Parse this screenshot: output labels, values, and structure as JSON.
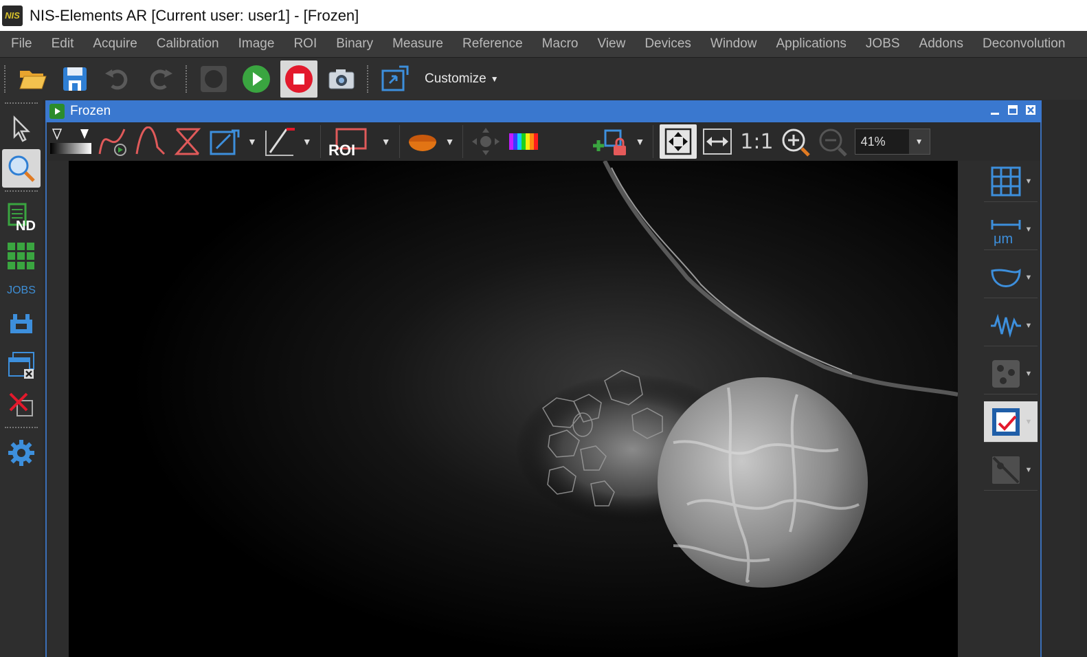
{
  "window": {
    "logo_text": "NIS",
    "title": "NIS-Elements AR [Current user: user1]  - [Frozen]"
  },
  "menu": [
    "File",
    "Edit",
    "Acquire",
    "Calibration",
    "Image",
    "ROI",
    "Binary",
    "Measure",
    "Reference",
    "Macro",
    "View",
    "Devices",
    "Window",
    "Applications",
    "JOBS",
    "Addons",
    "Deconvolution"
  ],
  "toolbar": {
    "customize_label": "Customize",
    "icons": [
      "open-folder-icon",
      "save-icon",
      "undo-icon",
      "redo-icon",
      "live-off-icon",
      "play-icon",
      "stop-icon",
      "camera-icon",
      "export-icon"
    ]
  },
  "leftbar": {
    "jobs_label": "JOBS",
    "icons": [
      "pointer-icon",
      "zoom-icon",
      "nd-acquisition-icon",
      "grid-icon",
      "jobs",
      "devices-icon",
      "close-windows-icon",
      "remove-icon",
      "settings-gear-icon"
    ]
  },
  "document": {
    "title": "Frozen",
    "zoom_value": "41%",
    "one_to_one_label": "1:1",
    "roi_label": "ROI",
    "accent": "#3a78cf"
  },
  "rightpanel": {
    "icons": [
      "grid-overlay-icon",
      "scale-bar-icon",
      "annotation-shape-icon",
      "intensity-profile-icon",
      "binary-layer-icon",
      "checked-layer-icon",
      "hidden-layer-icon"
    ],
    "scale_unit": "μm"
  }
}
